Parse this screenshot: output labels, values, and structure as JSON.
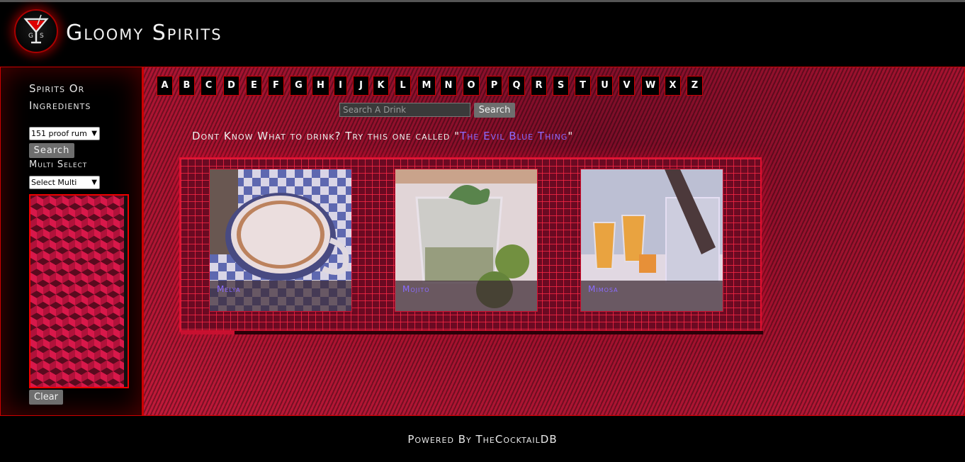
{
  "header": {
    "logo_text_left": "G",
    "logo_text_right": "S",
    "title": "Gloomy Spirits"
  },
  "sidebar": {
    "heading": "Spirits Or Ingredients",
    "spirit_select_value": "151 proof rum",
    "search_label": "Search",
    "multi_label": "Multi Select",
    "multi_select_value": "Select Multi",
    "clear_label": "Clear"
  },
  "main": {
    "letters": [
      "A",
      "B",
      "C",
      "D",
      "E",
      "F",
      "G",
      "H",
      "I",
      "J",
      "K",
      "L",
      "M",
      "N",
      "O",
      "P",
      "Q",
      "R",
      "S",
      "T",
      "U",
      "V",
      "W",
      "X",
      "Z"
    ],
    "search": {
      "placeholder": "Search A Drink",
      "button_label": "Search"
    },
    "suggestion": {
      "prefix": "Dont Know What to drink? Try this one called ",
      "open_quote": "\"",
      "drink_name": "The Evil Blue Thing",
      "close_quote": "\""
    },
    "drinks": [
      {
        "name": "Melya"
      },
      {
        "name": "Mojito"
      },
      {
        "name": "Mimosa"
      }
    ]
  },
  "footer": {
    "text": "Powered By TheCocktailDB"
  },
  "colors": {
    "accent_red": "#cc0000",
    "link_purple": "#8b6bff",
    "button_grey": "#6e6e6e"
  }
}
